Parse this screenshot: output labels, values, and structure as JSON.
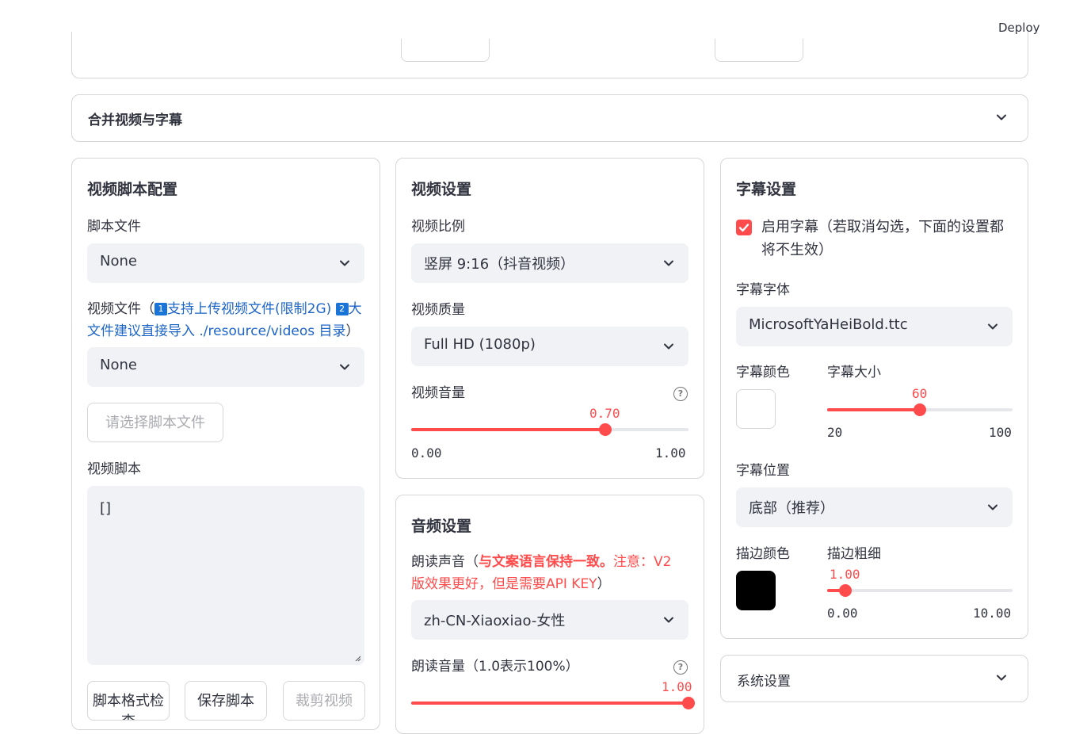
{
  "header": {
    "deploy_label": "Deploy"
  },
  "merge_expander": {
    "title": "合并视频与字幕"
  },
  "script_config": {
    "title": "视频脚本配置",
    "script_file": {
      "label": "脚本文件",
      "value": "None"
    },
    "video_file": {
      "label_prefix": "视频文件（",
      "badge1": "1",
      "link1": "支持上传视频文件(限制2G)",
      "badge2": "2",
      "link2": "大文件建议直接导入 ./resource/videos 目录",
      "label_suffix": "）",
      "value": "None"
    },
    "choose_script_button": "请选择脚本文件",
    "video_script": {
      "label": "视频脚本",
      "value": "[]"
    },
    "buttons": {
      "format": "脚本格式检查",
      "save": "保存脚本",
      "crop": "裁剪视频"
    }
  },
  "video_settings": {
    "title": "视频设置",
    "ratio": {
      "label": "视频比例",
      "value": "竖屏 9:16（抖音视频）"
    },
    "quality": {
      "label": "视频质量",
      "value": "Full HD (1080p)"
    },
    "volume": {
      "label": "视频音量",
      "value": "0.70",
      "min": "0.00",
      "max": "1.00",
      "fraction": 0.7
    }
  },
  "audio_settings": {
    "title": "音频设置",
    "voice": {
      "label_prefix": "朗读声音（",
      "bold_red": "与文案语言保持一致。",
      "red": "注意：V2版效果更好，但是需要API KEY",
      "label_suffix": "）",
      "value": "zh-CN-Xiaoxiao-女性"
    },
    "volume": {
      "label": "朗读音量（1.0表示100%）",
      "value": "1.00",
      "fraction": 1.0
    }
  },
  "subtitle_settings": {
    "title": "字幕设置",
    "enable": {
      "label": "启用字幕（若取消勾选，下面的设置都将不生效）",
      "checked": true
    },
    "font": {
      "label": "字幕字体",
      "value": "MicrosoftYaHeiBold.ttc"
    },
    "color": {
      "label": "字幕颜色",
      "value": "#ffffff"
    },
    "size": {
      "label": "字幕大小",
      "value": "60",
      "min": "20",
      "max": "100",
      "fraction": 0.5
    },
    "position": {
      "label": "字幕位置",
      "value": "底部（推荐）"
    },
    "stroke_color": {
      "label": "描边颜色",
      "value": "#000000"
    },
    "stroke_width": {
      "label": "描边粗细",
      "value": "1.00",
      "min": "0.00",
      "max": "10.00",
      "fraction": 0.1
    }
  },
  "system_expander": {
    "title": "系统设置"
  },
  "colors": {
    "accent": "#ff4b4b",
    "link": "#1c64c7",
    "input_bg": "#f0f2f6",
    "border": "#d6d6d9"
  }
}
